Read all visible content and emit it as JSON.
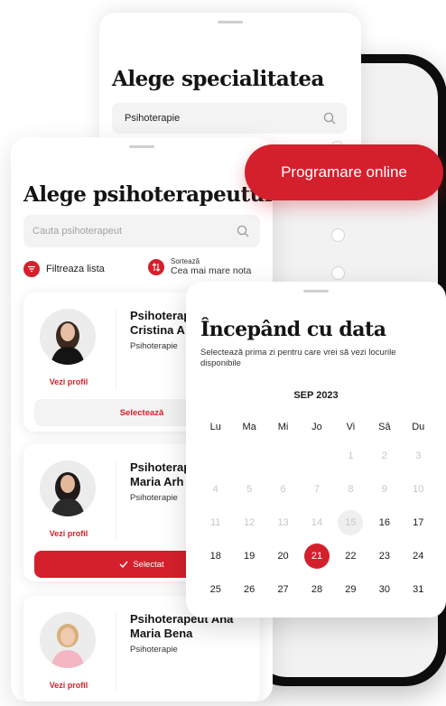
{
  "specialty": {
    "title": "Alege specialitatea",
    "field_value": "Psihoterapie"
  },
  "cta": {
    "label": "Programare online"
  },
  "therapists": {
    "title": "Alege psihoterapeutul",
    "search_placeholder": "Cauta psihoterapeut",
    "filter_label": "Filtreaza lista",
    "sort_caption": "Sortează",
    "sort_value": "Cea mai mare nota",
    "profile_link": "Vezi profil",
    "items": [
      {
        "name_line1": "Psihoterap",
        "name_line2": "Cristina A",
        "specialty": "Psihoterapie",
        "button": "Selectează"
      },
      {
        "name_line1": "Psihoterap",
        "name_line2": "Maria Arh",
        "specialty": "Psihoterapie",
        "button": "Selectat"
      },
      {
        "name_line1": "Psihoterapeut Ana",
        "name_line2": "Maria Bena",
        "specialty": "Psihoterapie"
      }
    ]
  },
  "calendar": {
    "title": "Începând cu data",
    "subtitle": "Selectează prima zi pentru care vrei să vezi locurile disponibile",
    "month": "SEP 2023",
    "weekdays": [
      "Lu",
      "Ma",
      "Mi",
      "Jo",
      "Vi",
      "Sâ",
      "Du"
    ],
    "weeks": [
      [
        "",
        "",
        "",
        "",
        "1",
        "2",
        "3"
      ],
      [
        "4",
        "5",
        "6",
        "7",
        "8",
        "9",
        "10"
      ],
      [
        "11",
        "12",
        "13",
        "14",
        "15",
        "16",
        "17"
      ],
      [
        "18",
        "19",
        "20",
        "21",
        "22",
        "23",
        "24"
      ],
      [
        "25",
        "26",
        "27",
        "28",
        "29",
        "30",
        "31"
      ]
    ],
    "selected_day": "21",
    "highlighted_day": "15"
  },
  "colors": {
    "accent": "#d4202c"
  }
}
